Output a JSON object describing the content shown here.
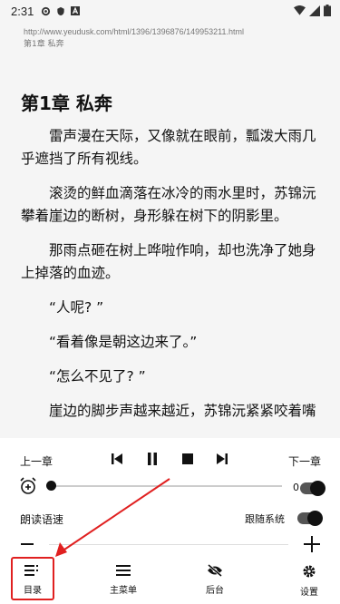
{
  "status": {
    "time": "2:31"
  },
  "header": {
    "url": "http://www.yeudusk.com/html/1396/1396876/149953211.html",
    "chapter_small": "第1章 私奔"
  },
  "chapter": {
    "title": "第1章 私奔",
    "paragraphs": [
      "雷声漫在天际，又像就在眼前，瓢泼大雨几乎遮挡了所有视线。",
      "滚烫的鲜血滴落在冰冷的雨水里时，苏锦沅攀着崖边的断树，身形躲在树下的阴影里。",
      "那雨点砸在树上哗啦作响，却也洗净了她身上掉落的血迹。",
      "“人呢? ”",
      "“看着像是朝这边来了。”",
      "“怎么不见了? ”",
      "崖边的脚步声越来越近，苏锦沅紧紧咬着嘴"
    ]
  },
  "player": {
    "prev_label": "上一章",
    "next_label": "下一章",
    "timer_value": "0 分钟",
    "timer_level": 0,
    "speed_label": "朗读语速",
    "follow_label": "跟随系统",
    "timer_toggle_on": true,
    "follow_toggle_on": true
  },
  "bottom_nav": {
    "items": [
      {
        "label": "目录",
        "icon": "list-icon"
      },
      {
        "label": "主菜单",
        "icon": "menu-icon"
      },
      {
        "label": "后台",
        "icon": "eye-off-icon"
      },
      {
        "label": "设置",
        "icon": "gear-icon"
      }
    ]
  },
  "colors": {
    "highlight": "#e02020",
    "accent": "#111111"
  }
}
